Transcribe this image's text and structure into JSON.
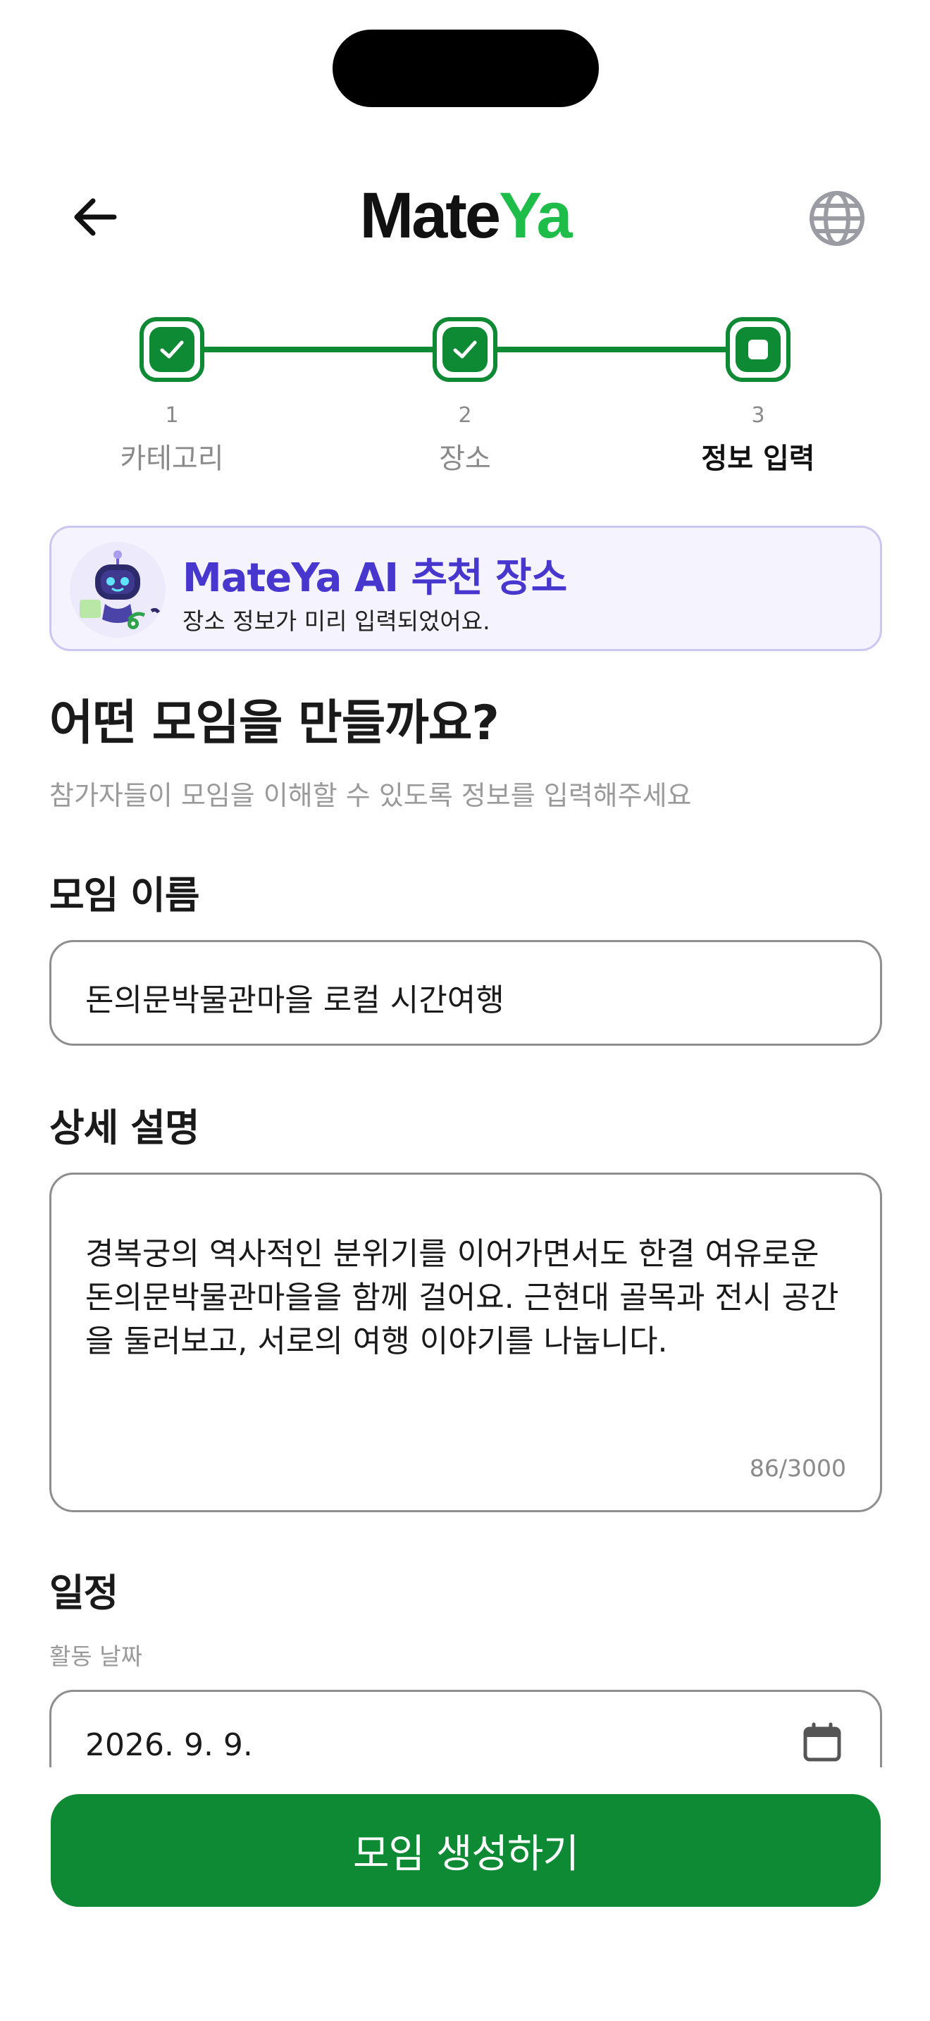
{
  "header": {
    "logo_part1": "Mate",
    "logo_part2": "Ya",
    "back_icon": "arrow-left-icon",
    "globe_icon": "globe-icon"
  },
  "stepper": {
    "steps": [
      {
        "number": "1",
        "label": "카테고리",
        "state": "done"
      },
      {
        "number": "2",
        "label": "장소",
        "state": "done"
      },
      {
        "number": "3",
        "label": "정보 입력",
        "state": "current"
      }
    ]
  },
  "banner": {
    "title": "MateYa AI 추천 장소",
    "subtitle": "장소 정보가 미리 입력되었어요."
  },
  "page": {
    "title": "어떤 모임을 만들까요?",
    "subtitle": "참가자들이 모임을 이해할 수 있도록 정보를 입력해주세요"
  },
  "form": {
    "name_label": "모임 이름",
    "name_value": "돈의문박물관마을 로컬 시간여행",
    "desc_label": "상세 설명",
    "desc_value": "경복궁의 역사적인 분위기를 이어가면서도 한결 여유로운 돈의문박물관마을을 함께 걸어요. 근현대 골목과 전시 공간을 둘러보고, 서로의 여행 이야기를 나눕니다.",
    "desc_counter": "86/3000",
    "schedule_label": "일정",
    "date_label": "활동 날짜",
    "date_value": "2026. 9. 9."
  },
  "cta": {
    "label": "모임 생성하기"
  },
  "colors": {
    "primary": "#0e8a35",
    "logo_accent": "#1ebd4a",
    "ai_accent": "#4737cf",
    "banner_bg": "#f5f4fe"
  }
}
